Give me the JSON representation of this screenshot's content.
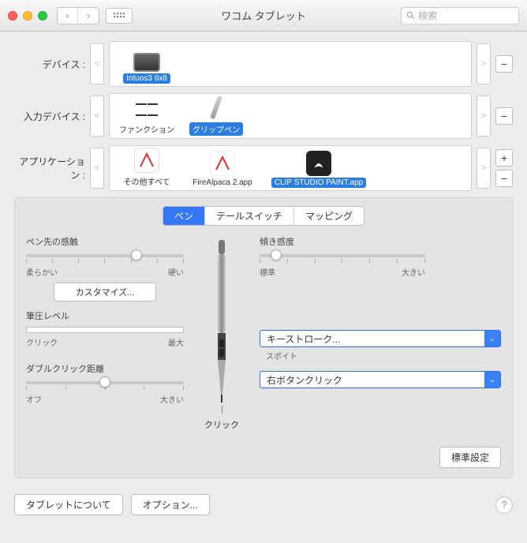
{
  "window": {
    "title": "ワコム タブレット",
    "search_placeholder": "検索"
  },
  "labels": {
    "device": "デバイス :",
    "input_device": "入力デバイス :",
    "application": "アプリケーション :"
  },
  "devices": {
    "items": [
      {
        "name": "Intuos3 6x8",
        "selected": true
      }
    ]
  },
  "input_devices": {
    "items": [
      {
        "name": "ファンクション",
        "selected": false
      },
      {
        "name": "グリップペン",
        "selected": true
      }
    ]
  },
  "applications": {
    "items": [
      {
        "name": "その他すべて",
        "selected": false
      },
      {
        "name": "FireAlpaca 2.app",
        "selected": false
      },
      {
        "name": "CLIP STUDIO PAINT.app",
        "selected": true
      }
    ]
  },
  "tabs": {
    "pen": "ペン",
    "tail": "テールスイッチ",
    "mapping": "マッピング",
    "active": "pen"
  },
  "pen_tab": {
    "feel_label": "ペン先の感触",
    "feel_soft": "柔らかい",
    "feel_hard": "硬い",
    "feel_value_pct": 70,
    "customize": "カスタマイズ...",
    "pressure_label": "筆圧レベル",
    "pressure_click": "クリック",
    "pressure_max": "最大",
    "tilt_label": "傾き感度",
    "tilt_low": "標準",
    "tilt_high": "大きい",
    "tilt_value_pct": 10,
    "dbl_label": "ダブルクリック距離",
    "dbl_off": "オフ",
    "dbl_high": "大きい",
    "dbl_value_pct": 50,
    "tip_label": "クリック",
    "upper_button": "キーストローク...",
    "upper_hint": "スポイト",
    "lower_button": "右ボタンクリック",
    "default": "標準設定"
  },
  "footer": {
    "about": "タブレットについて",
    "options": "オプション...",
    "help": "?"
  },
  "buttons": {
    "plus": "+",
    "minus": "−"
  }
}
